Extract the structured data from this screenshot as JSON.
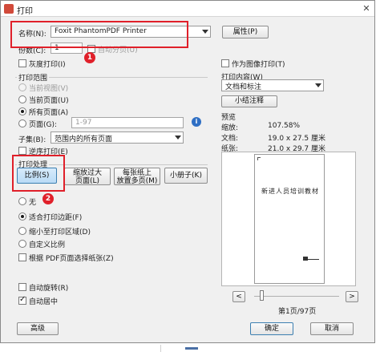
{
  "window": {
    "title": "打印",
    "close_glyph": "✕"
  },
  "printer": {
    "name_label": "名称(N):",
    "selected": "Foxit PhantomPDF Printer",
    "properties_button": "属性(P)",
    "copies_label": "份数(C):",
    "copies_value": "1",
    "collate_label": "自动分页(U)",
    "grayscale_label": "灰度打印(I)",
    "print_as_image_label": "作为图像打印(T)"
  },
  "range": {
    "title": "打印范围",
    "current_view": "当前视图(V)",
    "current_page": "当前页面(U)",
    "all_pages": "所有页面(A)",
    "pages_label": "页面(G):",
    "pages_value": "1-97",
    "info_glyph": "i",
    "subset_label": "子集(B):",
    "subset_selected": "范围内的所有页面",
    "reverse_label": "逆序打印(E)"
  },
  "content": {
    "title": "打印内容(W)",
    "selected": "文档和标注",
    "summary_button": "小结注释"
  },
  "handling": {
    "title": "打印处理",
    "buttons": [
      "比例(S)",
      "缩放过大\n页面(L)",
      "每张纸上\n放置多页(M)",
      "小册子(K)"
    ],
    "options": [
      "无",
      "适合打印边距(F)",
      "缩小至打印区域(D)",
      "自定义比例",
      "根据 PDF页面选择纸张(Z)"
    ]
  },
  "preview": {
    "title": "预览",
    "zoom_label": "缩放:",
    "zoom_value": "107.58%",
    "doc_label": "文档:",
    "doc_value": "19.0 x 27.5 厘米",
    "paper_label": "纸张:",
    "paper_value": "21.0 x 29.7 厘米",
    "page_heading": "新进人员培训教材",
    "page_status": "第1页/97页",
    "prev_glyph": "<",
    "next_glyph": ">"
  },
  "bottom": {
    "auto_rotate": "自动旋转(R)",
    "auto_center": "自动居中",
    "advanced_button": "高级",
    "ok_button": "确定",
    "cancel_button": "取消"
  },
  "annotations": {
    "badge_1": "1",
    "badge_2": "2"
  }
}
